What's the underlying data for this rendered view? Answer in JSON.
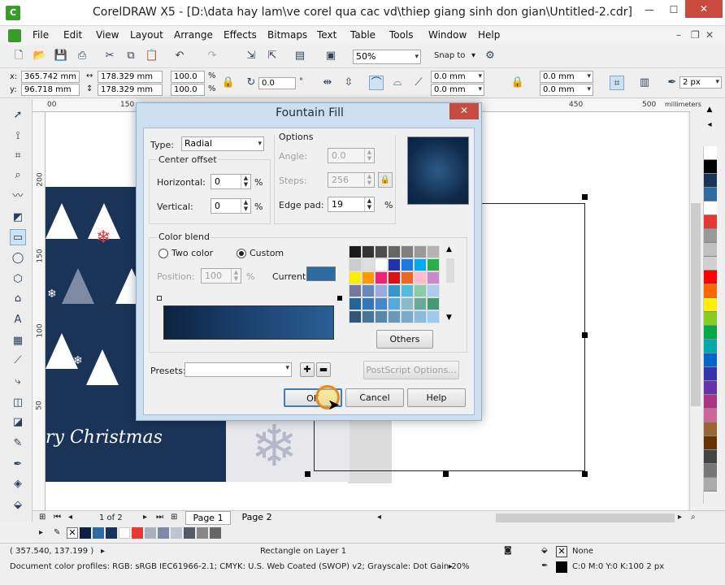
{
  "window": {
    "title": "CorelDRAW X5 - [D:\\data hay lam\\ve corel qua cac vd\\thiep giang sinh don gian\\Untitled-2.cdr]"
  },
  "menu": [
    "File",
    "Edit",
    "View",
    "Layout",
    "Arrange",
    "Effects",
    "Bitmaps",
    "Text",
    "Table",
    "Tools",
    "Window",
    "Help"
  ],
  "toolbar1": {
    "zoom": "50%",
    "snap_to": "Snap to"
  },
  "property_bar": {
    "x": "365.742 mm",
    "y": "96.718 mm",
    "width": "178.329 mm",
    "height": "178.329 mm",
    "scale_x": "100.0",
    "scale_y": "100.0",
    "percent": "%",
    "rotation": "0.0",
    "degree": "°",
    "corner_1": "0.0 mm",
    "corner_2": "0.0 mm",
    "corner_3": "0.0 mm",
    "corner_4": "0.0 mm",
    "outline": "2 px"
  },
  "ruler": {
    "top_labels": [
      "00",
      "150",
      "450",
      "500"
    ],
    "unit": "millimeters",
    "left_labels": [
      "200",
      "150",
      "100",
      "50"
    ]
  },
  "canvas": {
    "greeting": "ry Christmas"
  },
  "dialog": {
    "title": "Fountain Fill",
    "close": "✕",
    "type_label": "Type:",
    "type_value": "Radial",
    "center_offset_label": "Center offset",
    "horizontal_label": "Horizontal:",
    "horizontal_value": "0",
    "vertical_label": "Vertical:",
    "vertical_value": "0",
    "percent": "%",
    "options_label": "Options",
    "angle_label": "Angle:",
    "angle_value": "0.0",
    "steps_label": "Steps:",
    "steps_value": "256",
    "edge_pad_label": "Edge pad:",
    "edge_pad_value": "19",
    "color_blend_label": "Color blend",
    "two_color_label": "Two color",
    "custom_label": "Custom",
    "position_label": "Position:",
    "position_value": "100",
    "current_label": "Current:",
    "others_button": "Others",
    "presets_label": "Presets:",
    "presets_value": "",
    "postscript_button": "PostScript Options...",
    "ok_button": "OK",
    "cancel_button": "Cancel",
    "help_button": "Help",
    "palette_colors": [
      "#1a1a1a",
      "#333333",
      "#4d4d4d",
      "#666666",
      "#808080",
      "#999999",
      "#b3b3b3",
      "#cccccc",
      "#dddddd",
      "#ffffff",
      "#2233aa",
      "#1a7ae0",
      "#00aaee",
      "#2ab04a",
      "#ffee00",
      "#ff9900",
      "#ee2277",
      "#dd1111",
      "#ee6622",
      "#ffbbcc",
      "#cc88cc",
      "#777799",
      "#6688bb",
      "#99aadd",
      "#3399cc",
      "#55bbdd",
      "#88ccaa",
      "#aaccee",
      "#226699",
      "#3377bb",
      "#4488cc",
      "#55aadd",
      "#88bbcc",
      "#66aa99",
      "#449977",
      "#335577",
      "#447799",
      "#5588aa",
      "#6699bb",
      "#77aacc",
      "#88bbdd",
      "#99ccee"
    ]
  },
  "pagebar": {
    "page_count": "1 of 2",
    "page1": "Page 1",
    "page2": "Page 2"
  },
  "status": {
    "coords": "( 357.540, 137.199 )",
    "object": "Rectangle on Layer 1",
    "profiles": "Document color profiles: RGB: sRGB IEC61966-2.1; CMYK: U.S. Web Coated (SWOP) v2; Grayscale: Dot Gain 20%",
    "fill": "None",
    "outline": "C:0 M:0 Y:0 K:100  2 px"
  },
  "colors": {
    "accent": "#3a9a2a",
    "close_red": "#c94a3f",
    "card_navy": "#1a3458"
  },
  "palette_swatches": [
    "#ffffff",
    "#000000",
    "#1a3458",
    "#2d6ca3",
    "#ffffff",
    "#e53935",
    "#999999",
    "#c0c0c0",
    "#d0d0d0",
    "#ff0000",
    "#ff6600",
    "#ffee00",
    "#88cc22",
    "#00aa44",
    "#00aaaa",
    "#0066cc",
    "#3333aa",
    "#6633aa",
    "#aa3388",
    "#cc6699",
    "#996633",
    "#663300",
    "#444444",
    "#777777",
    "#aaaaaa"
  ]
}
